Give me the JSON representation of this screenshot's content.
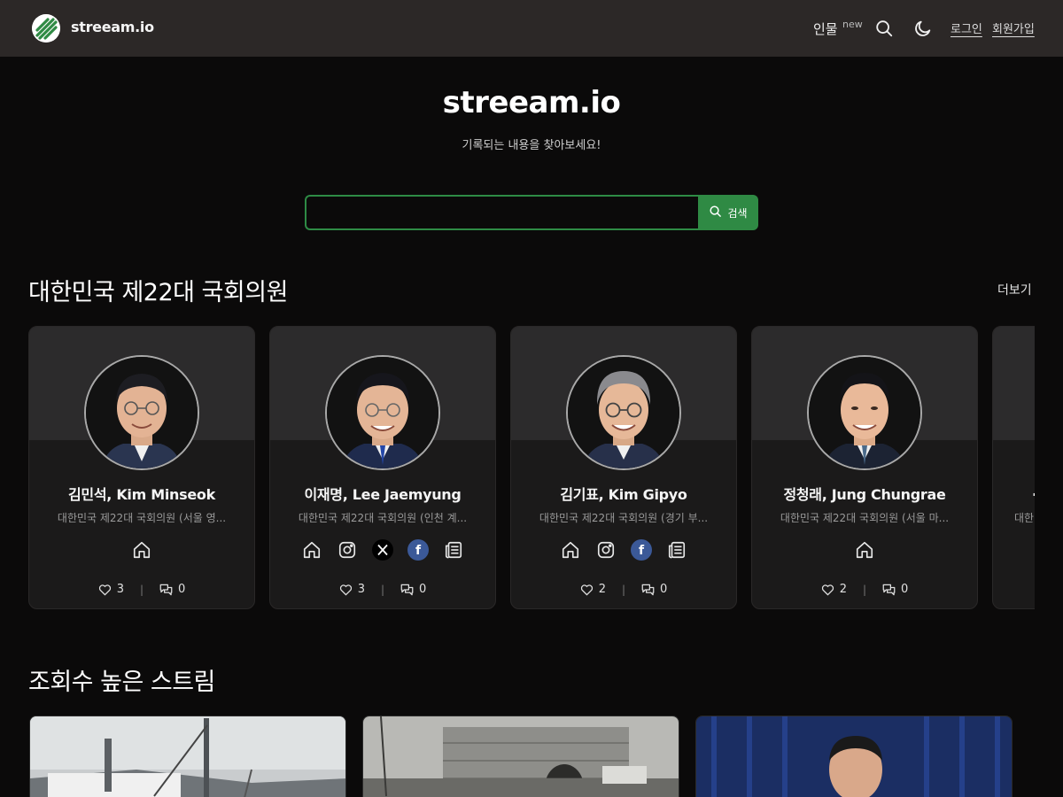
{
  "header": {
    "brand": "streeam.io",
    "nav_people": "인물",
    "nav_new_badge": "new",
    "login": "로그인",
    "signup": "회원가입",
    "icons": [
      "search-icon",
      "moon-icon"
    ]
  },
  "hero": {
    "title": "streeam.io",
    "subtitle": "기록되는 내용을 찾아보세요!",
    "search_value": "",
    "search_button": "검색"
  },
  "members_section": {
    "title": "대한민국 제22대 국회의원",
    "more": "더보기",
    "cards": [
      {
        "name": "김민석, Kim Minseok",
        "desc": "대한민국 제22대 국회의원 (서울 영...",
        "socials": [
          "home-icon"
        ],
        "likes": "3",
        "comments": "0"
      },
      {
        "name": "이재명, Lee Jaemyung",
        "desc": "대한민국 제22대 국회의원 (인천 계...",
        "socials": [
          "home-icon",
          "instagram-icon",
          "x-icon",
          "facebook-icon",
          "news-icon"
        ],
        "likes": "3",
        "comments": "0"
      },
      {
        "name": "김기표, Kim Gipyo",
        "desc": "대한민국 제22대 국회의원 (경기 부...",
        "socials": [
          "home-icon",
          "instagram-icon",
          "facebook-icon",
          "news-icon"
        ],
        "likes": "2",
        "comments": "0"
      },
      {
        "name": "정청래, Jung Chungrae",
        "desc": "대한민국 제22대 국회의원 (서울 마...",
        "socials": [
          "home-icon"
        ],
        "likes": "2",
        "comments": "0"
      },
      {
        "name": "...",
        "desc": "대한...",
        "socials": [],
        "likes": "",
        "comments": ""
      }
    ]
  },
  "streams_section": {
    "title": "조회수 높은 스트림"
  },
  "colors": {
    "accent": "#2f8a44",
    "background": "#0b0a0a",
    "header": "#2c2827",
    "card": "#1b1a1a"
  }
}
